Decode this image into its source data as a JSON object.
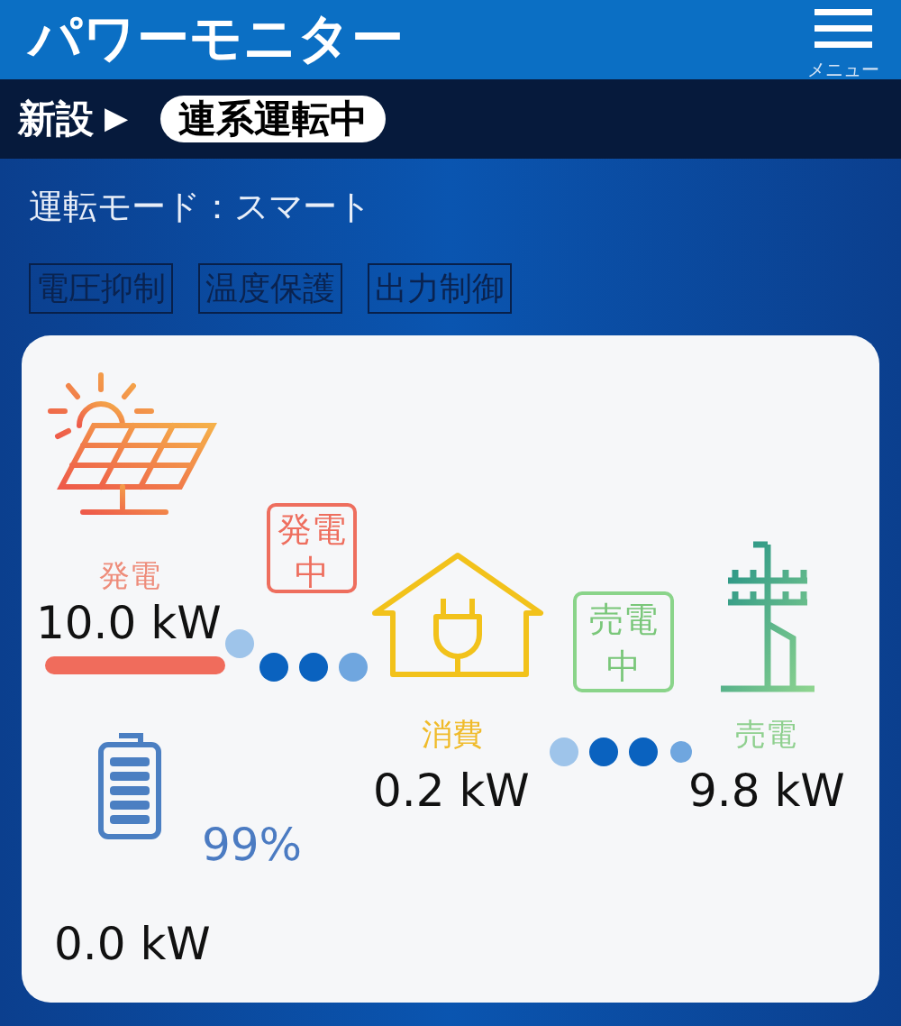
{
  "header": {
    "title": "パワーモニター",
    "menu_label": "メニュー"
  },
  "status_bar": {
    "install": "新設",
    "arrow": "▶",
    "state": "連系運転中"
  },
  "mode": "運転モード：スマート",
  "flags": [
    {
      "label": "電圧抑制",
      "on": false
    },
    {
      "label": "温度保護",
      "on": false
    },
    {
      "label": "出力制御",
      "on": false
    }
  ],
  "flow": {
    "solar": {
      "label": "発電",
      "value": "10.0 kW"
    },
    "generating_badge": "発電中",
    "consumption": {
      "label": "消費",
      "value": "0.2 kW"
    },
    "selling_badge": "売電中",
    "grid": {
      "label": "売電",
      "value": "9.8 kW"
    },
    "battery": {
      "percent": "99%",
      "value": "0.0 kW"
    }
  }
}
